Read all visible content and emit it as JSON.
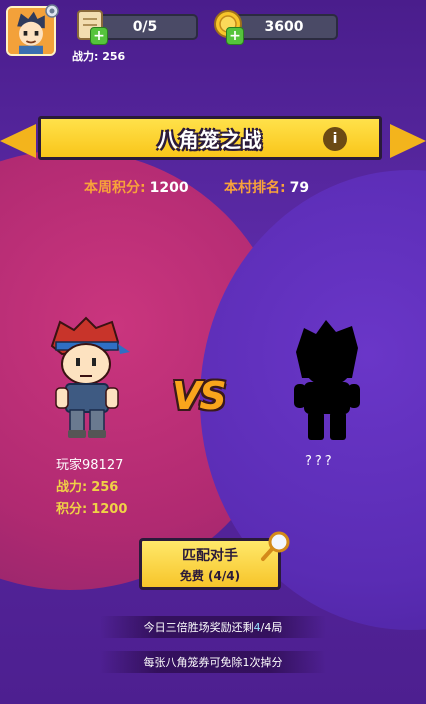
{
  "header": {
    "power_label": "战力:",
    "power_value": "256",
    "tickets": "0/5",
    "coins": "3600"
  },
  "banner": {
    "title": "八角笼之战"
  },
  "stats": {
    "weekly_label": "本周积分:",
    "weekly_value": "1200",
    "rank_label": "本村排名:",
    "rank_value": "79"
  },
  "vs_text": "VS",
  "player": {
    "name": "玩家98127",
    "power_label": "战力:",
    "power_value": "256",
    "score_label": "积分:",
    "score_value": "1200"
  },
  "opponent": {
    "name": "???"
  },
  "match_button": {
    "title": "匹配对手",
    "subtitle": "免费 (4/4)"
  },
  "notices": {
    "line1_prefix": "今日三倍胜场奖励还剩",
    "line1_highlight": "4",
    "line1_suffix": "/4局",
    "line2": "每张八角笼券可免除1次掉分"
  },
  "colors": {
    "accent": "#f9c61a",
    "label": "#f8a23a",
    "bg_left": "#c0306f",
    "bg_right": "#5a2cb4"
  },
  "icons": [
    "gear-icon",
    "ticket-icon",
    "coin-icon",
    "plus-icon",
    "info-icon",
    "magnifier-icon"
  ]
}
